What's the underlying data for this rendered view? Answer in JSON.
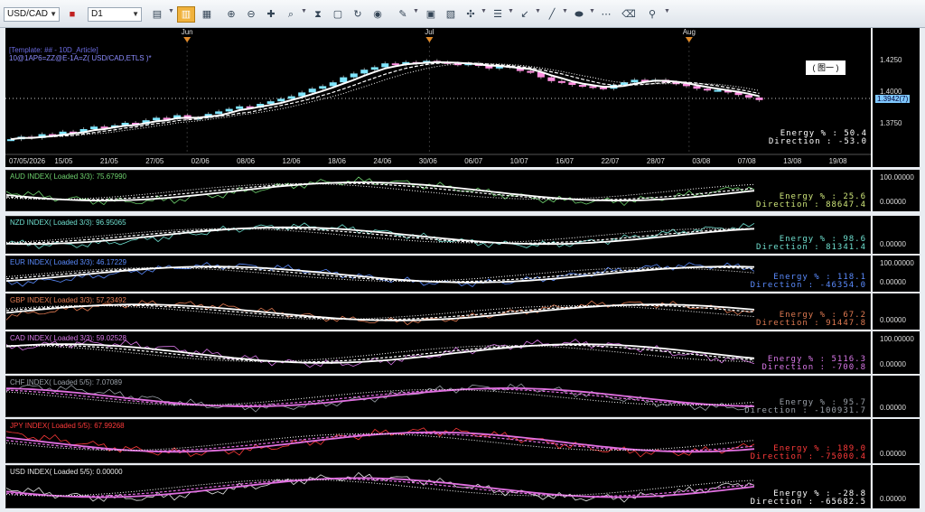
{
  "toolbar": {
    "symbol": "USD/CAD",
    "timeframe": "D1",
    "buttons": [
      "chart-type",
      "color",
      "candle",
      "bar-style",
      "zoom-in",
      "zoom-out",
      "crosshair",
      "period",
      "object",
      "rotate",
      "globe",
      "pencil",
      "image",
      "image2",
      "fib",
      "menu",
      "arrow",
      "line",
      "ellipse",
      "eraser",
      "tree"
    ]
  },
  "main": {
    "template": "[Template: ## - 10D_Article]",
    "formula": "10@1AP6=ZZ@E-1A=Z( USD/CAD,ETLS )*",
    "months": [
      {
        "label": "Jun",
        "pos": 0.21
      },
      {
        "label": "Jul",
        "pos": 0.49
      },
      {
        "label": "Aug",
        "pos": 0.79
      }
    ],
    "dates": [
      "07/05/2026",
      "15/05",
      "21/05",
      "27/05",
      "02/06",
      "08/06",
      "12/06",
      "18/06",
      "24/06",
      "30/06",
      "06/07",
      "10/07",
      "16/07",
      "22/07",
      "28/07",
      "03/08",
      "07/08",
      "13/08",
      "19/08"
    ],
    "price_ticks": [
      "1.4250",
      "1.4000",
      "1.3750"
    ],
    "current_price": "1.3942(7)",
    "annotation": "( 图一 )",
    "energy": "Energy % : 50.4",
    "direction": "Direction : -53.0",
    "candles": [
      1.364,
      1.366,
      1.365,
      1.368,
      1.367,
      1.37,
      1.369,
      1.372,
      1.374,
      1.373,
      1.375,
      1.377,
      1.376,
      1.379,
      1.381,
      1.38,
      1.383,
      1.38,
      1.381,
      1.384,
      1.386,
      1.388,
      1.39,
      1.389,
      1.392,
      1.394,
      1.396,
      1.398,
      1.401,
      1.404,
      1.406,
      1.409,
      1.413,
      1.416,
      1.419,
      1.421,
      1.424,
      1.423,
      1.425,
      1.424,
      1.426,
      1.425,
      1.424,
      1.423,
      1.424,
      1.422,
      1.42,
      1.422,
      1.421,
      1.418,
      1.417,
      1.413,
      1.41,
      1.409,
      1.407,
      1.406,
      1.405,
      1.404,
      1.407,
      1.409,
      1.411,
      1.41,
      1.411,
      1.409,
      1.408,
      1.406,
      1.404,
      1.403,
      1.403,
      1.401,
      1.399,
      1.397,
      1.395
    ]
  },
  "panes": [
    {
      "label": "AUD INDEX( Loaded 3/3): 75.67990",
      "color": "#6fd36f",
      "energy": "Energy % : 25.6",
      "direction": "Direction : 88647.4",
      "energy_color": "#cfe67a",
      "direction_color": "#cfe67a",
      "scale_top": "100.00000",
      "scale_bottom": "0.00000",
      "lines": "#ffffff"
    },
    {
      "label": "NZD INDEX( Loaded 3/3): 96.95065",
      "color": "#6fe0d0",
      "energy": "Energy % : 98.6",
      "direction": "Direction : 81341.4",
      "energy_color": "#6fe0d0",
      "direction_color": "#6fe0d0",
      "scale_top": "",
      "scale_bottom": "0.00000",
      "lines": "#ffffff"
    },
    {
      "label": "EUR INDEX( Loaded 3/3): 46.17229",
      "color": "#5b8cff",
      "energy": "Energy % : 118.1",
      "direction": "Direction : -46354.0",
      "energy_color": "#5b8cff",
      "direction_color": "#5b8cff",
      "scale_top": "100.00000",
      "scale_bottom": "0.00000",
      "lines": "#ffffff"
    },
    {
      "label": "GBP INDEX( Loaded 3/3): 57.23492",
      "color": "#e07a52",
      "energy": "Energy % : 67.2",
      "direction": "Direction : 91447.8",
      "energy_color": "#e07a52",
      "direction_color": "#e07a52",
      "scale_top": "",
      "scale_bottom": "0.00000",
      "lines": "#ffffff"
    },
    {
      "label": "CAD INDEX( Loaded 3/3): 59.02528",
      "color": "#d977e8",
      "energy": "Energy % : 5116.3",
      "direction": "Direction : -700.8",
      "energy_color": "#d977e8",
      "direction_color": "#d977e8",
      "scale_top": "100.00000",
      "scale_bottom": "0.00000",
      "lines": "#ffffff"
    },
    {
      "label": "CHF INDEX( Loaded 5/5): 7.07089",
      "color": "#9aa0a8",
      "energy": "Energy % : 95.7",
      "direction": "Direction : -100931.7",
      "energy_color": "#9aa0a8",
      "direction_color": "#9aa0a8",
      "scale_top": "",
      "scale_bottom": "0.00000",
      "lines": "#e070e0"
    },
    {
      "label": "JPY INDEX( Loaded 5/5): 67.99268",
      "color": "#ff3a3a",
      "energy": "Energy % : 189.0",
      "direction": "Direction : -75000.4",
      "energy_color": "#ff3a3a",
      "direction_color": "#ff3a3a",
      "scale_top": "",
      "scale_bottom": "0.00000",
      "lines": "#e070e0"
    },
    {
      "label": "USD INDEX( Loaded 5/5): 0.00000",
      "color": "#e8e8e8",
      "energy": "Energy % : -28.8",
      "direction": "Direction : -65682.5",
      "energy_color": "#ffffff",
      "direction_color": "#ffffff",
      "scale_top": "",
      "scale_bottom": "0.00000",
      "lines": "#e070e0"
    }
  ]
}
